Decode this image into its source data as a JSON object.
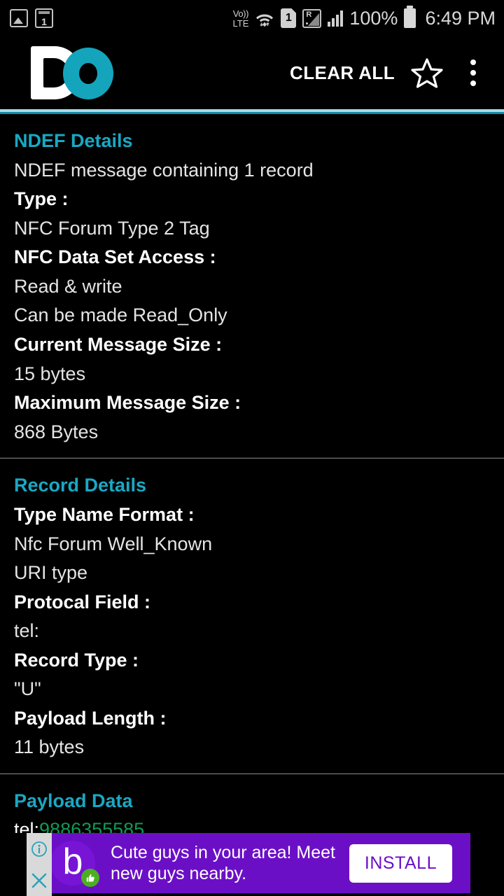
{
  "status_bar": {
    "left_icons": [
      {
        "name": "photo-icon",
        "glyph": "image"
      },
      {
        "name": "calendar-icon",
        "glyph": "1"
      }
    ],
    "calendar_day": "1",
    "volte_line1": "Vo))",
    "volte_line2": "LTE",
    "sim_label": "1",
    "roaming_label": "R",
    "battery_percent": "100%",
    "time": "6:49 PM"
  },
  "app_bar": {
    "logo_alt": "DO",
    "clear_all_label": "CLEAR ALL",
    "star_label": "favorite",
    "overflow_label": "more options"
  },
  "colors": {
    "accent": "#19a8c4",
    "accent_rule": "#a9dbe8",
    "link_green": "#0f9b53",
    "ad_purple": "#6b0fc7",
    "ad_badge_green": "#4caf22",
    "logo_cyan": "#14a5bd"
  },
  "sections": [
    {
      "title": "NDEF Details",
      "rows": [
        {
          "kind": "value",
          "text": "NDEF message containing 1 record"
        },
        {
          "kind": "label",
          "text": "Type :"
        },
        {
          "kind": "value",
          "text": "NFC Forum Type 2 Tag"
        },
        {
          "kind": "label",
          "text": "NFC Data Set Access :"
        },
        {
          "kind": "value",
          "text": "Read & write"
        },
        {
          "kind": "value",
          "text": "Can be made Read_Only"
        },
        {
          "kind": "label",
          "text": "Current Message Size :"
        },
        {
          "kind": "value",
          "text": "15 bytes"
        },
        {
          "kind": "label",
          "text": "Maximum Message Size :"
        },
        {
          "kind": "value",
          "text": "868 Bytes"
        }
      ]
    },
    {
      "title": "Record Details",
      "rows": [
        {
          "kind": "label",
          "text": "Type Name Format :"
        },
        {
          "kind": "value",
          "text": "Nfc Forum Well_Known"
        },
        {
          "kind": "value",
          "text": "URI type"
        },
        {
          "kind": "label",
          "text": "Protocal Field :"
        },
        {
          "kind": "value",
          "text": "tel:"
        },
        {
          "kind": "label",
          "text": "Record Type :"
        },
        {
          "kind": "value",
          "text": "\"U\""
        },
        {
          "kind": "label",
          "text": "Payload Length :"
        },
        {
          "kind": "value",
          "text": "11 bytes"
        }
      ]
    }
  ],
  "payload": {
    "title": "Payload Data",
    "prefix": "tel:",
    "link_text": "9886355585"
  },
  "ad": {
    "logo_letter": "b",
    "badge_glyph": "✋",
    "headline": "Cute guys in your area! Meet new guys nearby.",
    "install_label": "INSTALL",
    "info_glyph": "ⓘ",
    "close_glyph": "✕"
  }
}
